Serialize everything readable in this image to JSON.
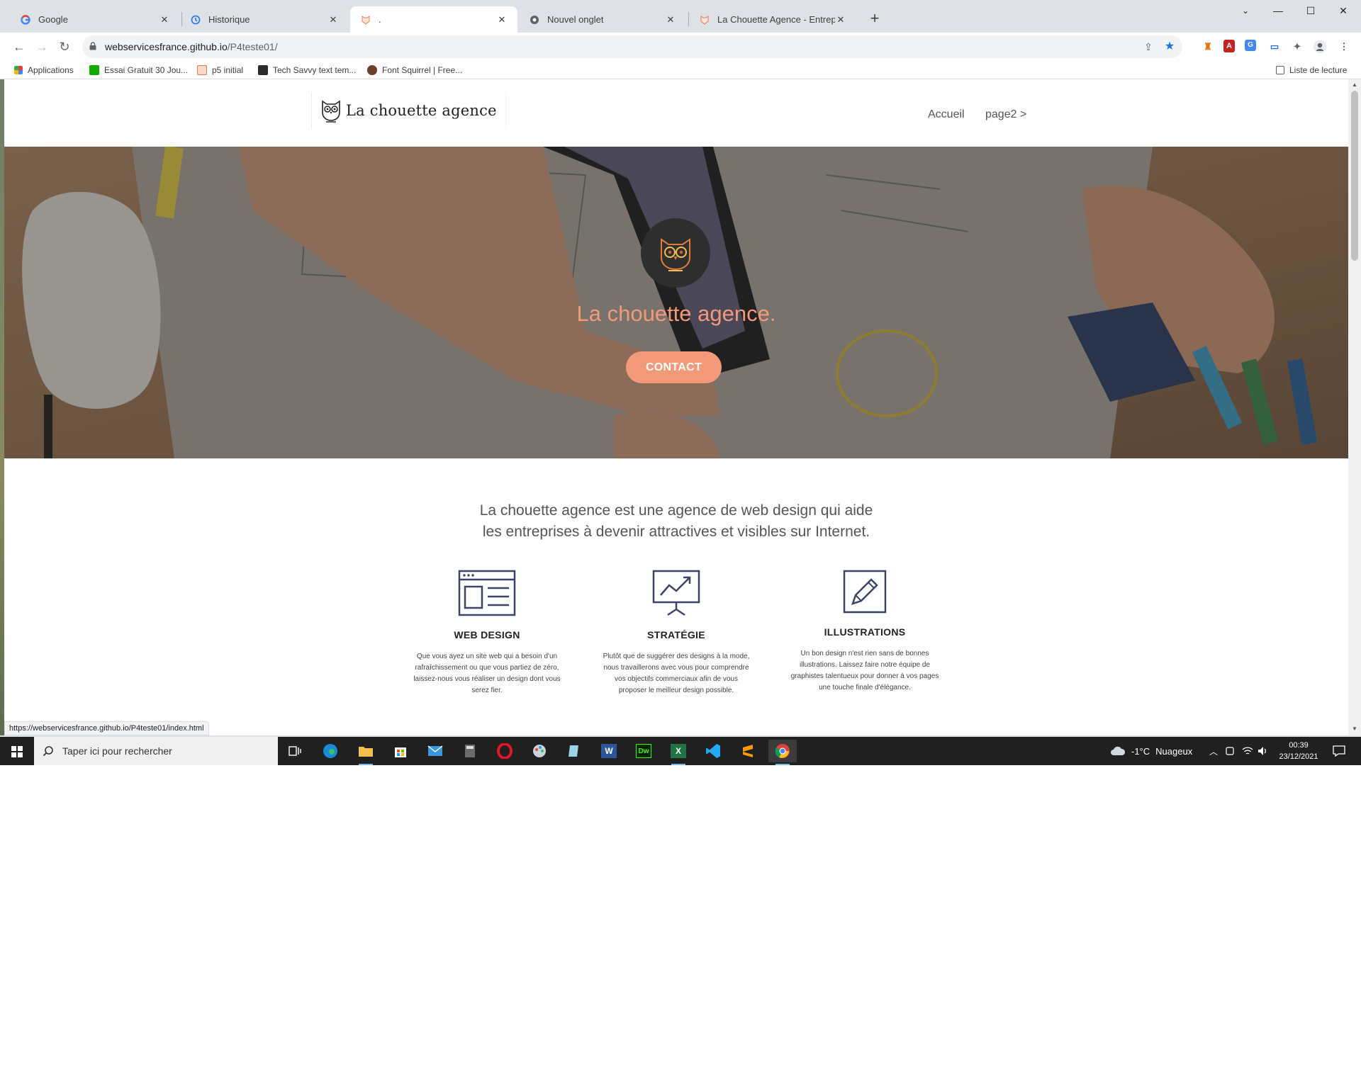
{
  "browser": {
    "tabs": [
      {
        "label": "Google",
        "active": false
      },
      {
        "label": "Historique",
        "active": false
      },
      {
        "label": ".",
        "active": true
      },
      {
        "label": "Nouvel onglet",
        "active": false
      },
      {
        "label": "La Chouette Agence - Entreprise",
        "active": false
      }
    ],
    "url_host": "webservicesfrance.github.io",
    "url_path": "/P4teste01/",
    "bookmarks": [
      {
        "label": "Applications"
      },
      {
        "label": "Essai Gratuit 30 Jou..."
      },
      {
        "label": "p5 initial"
      },
      {
        "label": "Tech Savvy text tem..."
      },
      {
        "label": "Font Squirrel | Free..."
      }
    ],
    "reading_list": "Liste de lecture",
    "status_url": "https://webservicesfrance.github.io/P4teste01/index.html"
  },
  "site": {
    "logo_text": "La chouette agence",
    "nav": [
      {
        "label": "Accueil"
      },
      {
        "label": "page2 >"
      }
    ],
    "hero": {
      "title": "La chouette agence.",
      "cta": "CONTACT"
    },
    "intro": {
      "line1": "La chouette agence est une agence de web design qui aide",
      "line2": "les entreprises à devenir attractives et visibles sur Internet."
    },
    "features": [
      {
        "icon": "web-design-icon",
        "title": "WEB DESIGN",
        "lines": [
          "Que vous ayez un site web qui a besoin d'un",
          "rafraîchissement ou que vous partiez de zéro,",
          "laissez-nous vous réaliser un design dont vous",
          "serez fier."
        ]
      },
      {
        "icon": "strategy-icon",
        "title": "STRATÉGIE",
        "lines": [
          "Plutôt que de suggérer des designs à la mode,",
          "nous travaillerons avec vous pour comprendre",
          "vos objectifs commerciaux afin de vous",
          "proposer le meilleur design possible."
        ]
      },
      {
        "icon": "illustration-icon",
        "title": "ILLUSTRATIONS",
        "lines": [
          "Un bon design n'est rien sans de bonnes",
          "illustrations. Laissez faire notre équipe de",
          "graphistes talentueux pour donner à vos pages",
          "une touche finale d'élégance."
        ]
      }
    ],
    "colors": {
      "accent": "#f2997a",
      "icon": "#3d4466"
    }
  },
  "taskbar": {
    "search_placeholder": "Taper ici pour rechercher",
    "weather_temp": "-1°C",
    "weather_text": "Nuageux",
    "time": "00:39",
    "date": "23/12/2021",
    "apps": [
      "task-view",
      "edge",
      "file-explorer",
      "store",
      "mail",
      "calculator",
      "opera",
      "paint",
      "notepad",
      "word",
      "dreamweaver",
      "excel",
      "vscode",
      "sublime",
      "chrome"
    ]
  }
}
